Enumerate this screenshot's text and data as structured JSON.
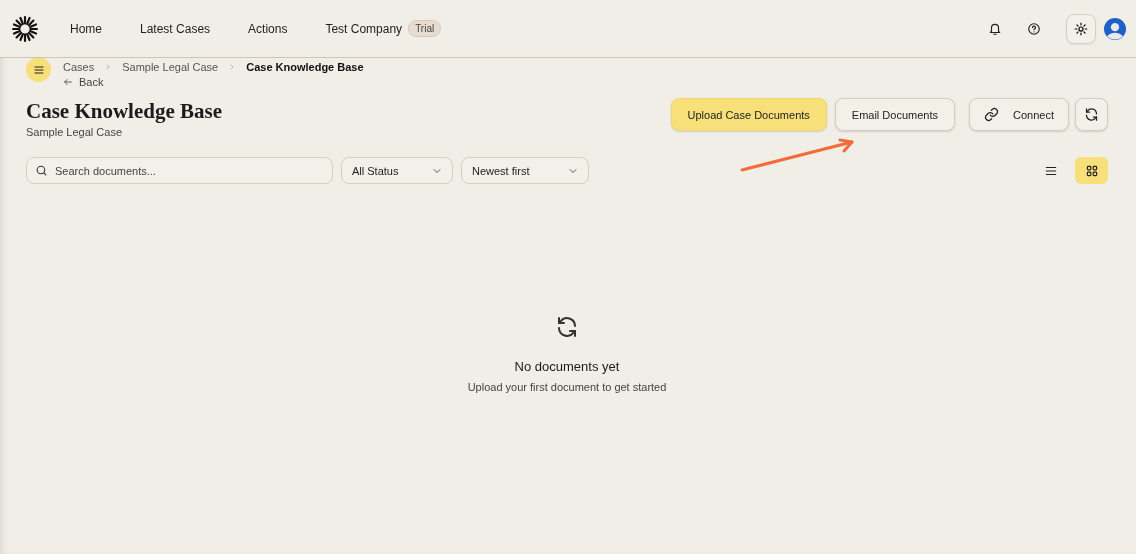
{
  "nav": {
    "items": [
      {
        "label": "Home"
      },
      {
        "label": "Latest Cases"
      },
      {
        "label": "Actions"
      }
    ],
    "company": "Test Company",
    "company_badge": "Trial"
  },
  "breadcrumb": [
    "Cases",
    "Sample Legal Case",
    "Case Knowledge Base"
  ],
  "back": "Back",
  "page": {
    "title": "Case Knowledge Base",
    "subtitle": "Sample Legal Case"
  },
  "actions": [
    {
      "kind": "primary",
      "label": "Upload Case Documents"
    },
    {
      "kind": "secondary",
      "label": "Email Documents"
    },
    {
      "kind": "link",
      "label": "Connect"
    },
    {
      "kind": "refresh"
    }
  ],
  "search": {
    "placeholder": "Search documents..."
  },
  "filters": [
    {
      "label": "All Status"
    },
    {
      "label": "Newest first"
    }
  ],
  "views": [
    {
      "kind": "list",
      "selected": false
    },
    {
      "kind": "grid",
      "selected": true
    }
  ],
  "empty": {
    "title": "No documents yet",
    "text": "Upload your first document to get started"
  }
}
